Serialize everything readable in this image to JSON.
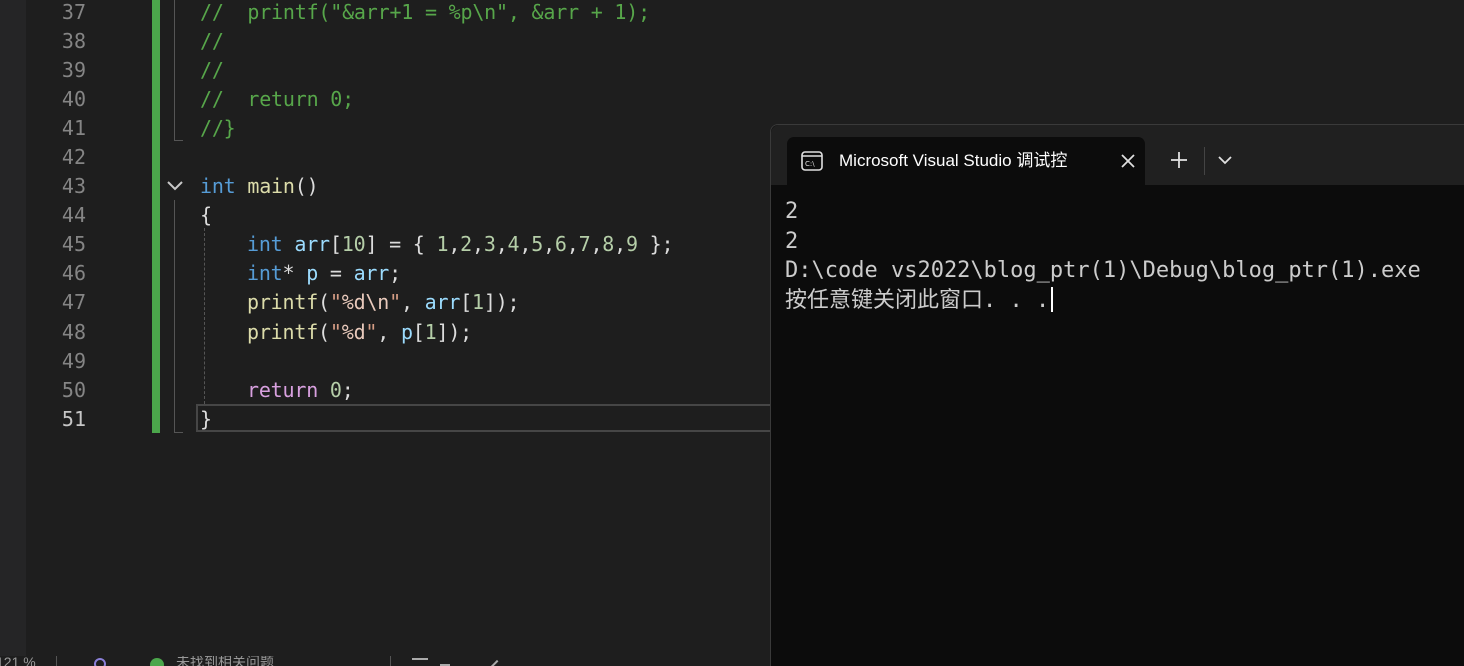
{
  "editor": {
    "current_line": "51",
    "lines": [
      {
        "n": "37",
        "text": "//  printf(\"&arr+1 = %p\\n\", &arr + 1);"
      },
      {
        "n": "38",
        "text": "//"
      },
      {
        "n": "39",
        "text": "//"
      },
      {
        "n": "40",
        "text": "//  return 0;"
      },
      {
        "n": "41",
        "text": "//}"
      },
      {
        "n": "42",
        "text": ""
      },
      {
        "n": "43",
        "text": "int main()"
      },
      {
        "n": "44",
        "text": "{"
      },
      {
        "n": "45",
        "text": "int arr[10] = { 1,2,3,4,5,6,7,8,9 };"
      },
      {
        "n": "46",
        "text": "int* p = arr;"
      },
      {
        "n": "47",
        "text": "printf(\"%d\\n\", arr[1]);"
      },
      {
        "n": "48",
        "text": "printf(\"%d\", p[1]);"
      },
      {
        "n": "49",
        "text": ""
      },
      {
        "n": "50",
        "text": "return 0;"
      },
      {
        "n": "51",
        "text": "}"
      }
    ]
  },
  "terminal": {
    "tab_title": "Microsoft Visual Studio 调试控",
    "tab_icon": "console-icon",
    "output": [
      "2",
      "2",
      "D:\\code vs2022\\blog_ptr(1)\\Debug\\blog_ptr(1).exe",
      "按任意键关闭此窗口. . ."
    ]
  },
  "status": {
    "zoom": "121 %",
    "issues": "未找到相关问题"
  },
  "colors": {
    "editor_bg": "#1e1e1e",
    "change_bar": "#4ba64b",
    "keyword": "#569cd6",
    "comment": "#57a64a",
    "terminal_bg": "#0c0c0c"
  }
}
